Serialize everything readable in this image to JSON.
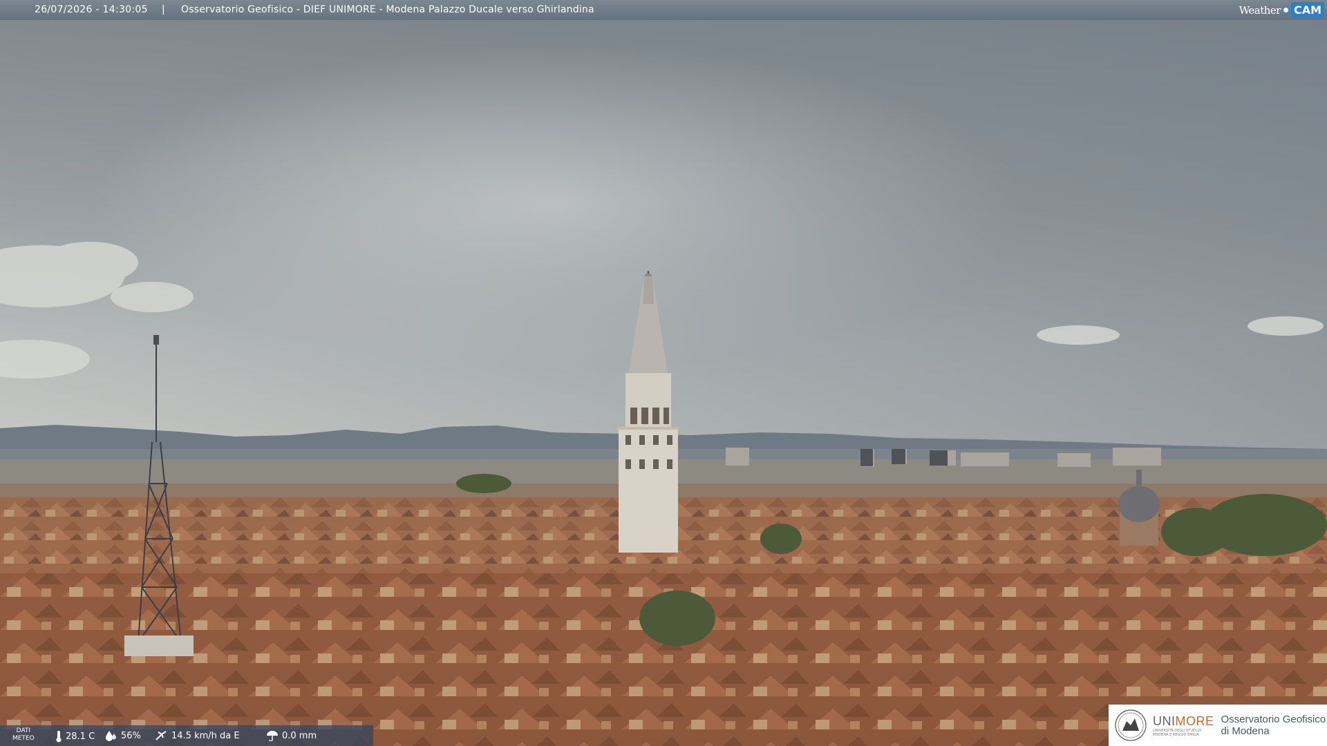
{
  "header": {
    "datetime": "26/07/2026 - 14:30:05",
    "separator": "|",
    "title": "Osservatorio Geofisico - DIEF UNIMORE - Modena Palazzo Ducale verso Ghirlandina",
    "brand_left": "Weather",
    "brand_right": "CAM"
  },
  "meteo": {
    "label_line1": "DATI",
    "label_line2": "METEO",
    "temperature": "28.1 C",
    "humidity": "56%",
    "wind": "14.5 km/h da E",
    "rain": "0.0 mm"
  },
  "logo": {
    "uni_prefix": "UNI",
    "uni_suffix": "MORE",
    "uni_small_1": "UNIVERSITÀ DEGLI STUDI DI",
    "uni_small_2": "MODENA E REGGIO EMILIA",
    "obs_line1": "Osservatorio Geofisico",
    "obs_line2": "di Modena"
  },
  "colors": {
    "sky_top": "#7d858b",
    "sky_light": "#c9cdcd",
    "roof": "#a5704e",
    "tower": "#d8d2c8",
    "brand_blue": "#2f7fc4",
    "unimore_orange": "#c96a2b"
  }
}
